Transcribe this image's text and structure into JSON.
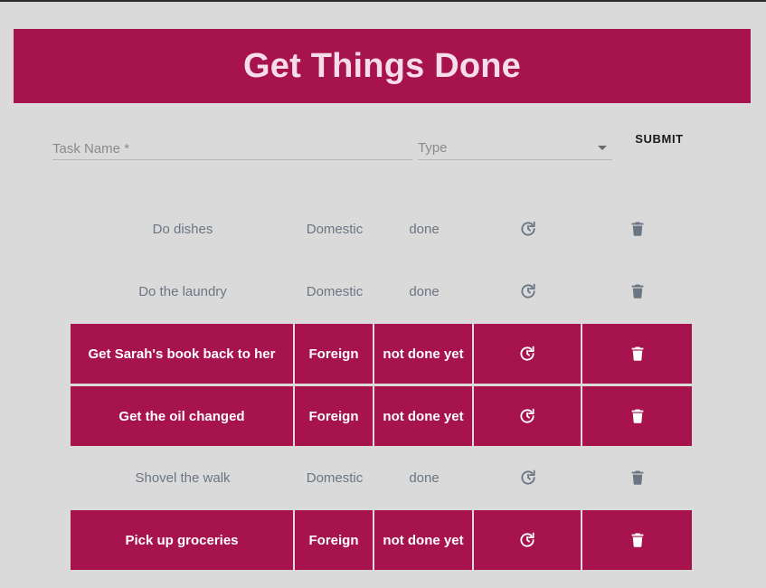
{
  "app": {
    "title": "Get Things Done"
  },
  "form": {
    "task_name_label": "Task Name *",
    "type_label": "Type",
    "submit_label": "SUBMIT"
  },
  "colors": {
    "accent": "#a6134d",
    "background": "#dadada",
    "done_text": "#6b7683",
    "header_text": "#f7dde8"
  },
  "tasks": [
    {
      "name": "Do dishes",
      "type": "Domestic",
      "status": "done",
      "done": true,
      "toggle_icon": "refresh-icon",
      "delete_icon": "trash-icon"
    },
    {
      "name": "Do the laundry",
      "type": "Domestic",
      "status": "done",
      "done": true,
      "toggle_icon": "refresh-icon",
      "delete_icon": "trash-icon"
    },
    {
      "name": "Get Sarah's book back to her",
      "type": "Foreign",
      "status": "not done yet",
      "done": false,
      "toggle_icon": "refresh-icon",
      "delete_icon": "trash-icon"
    },
    {
      "name": "Get the oil changed",
      "type": "Foreign",
      "status": "not done yet",
      "done": false,
      "toggle_icon": "refresh-icon",
      "delete_icon": "trash-icon"
    },
    {
      "name": "Shovel the walk",
      "type": "Domestic",
      "status": "done",
      "done": true,
      "toggle_icon": "refresh-icon",
      "delete_icon": "trash-icon"
    },
    {
      "name": "Pick up groceries",
      "type": "Foreign",
      "status": "not done yet",
      "done": false,
      "toggle_icon": "refresh-icon",
      "delete_icon": "trash-icon"
    }
  ]
}
